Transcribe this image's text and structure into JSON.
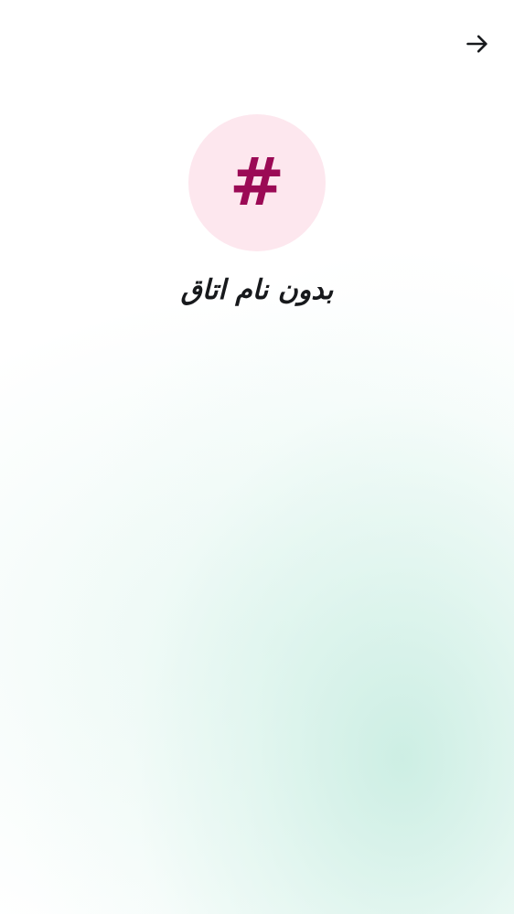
{
  "header": {
    "back_icon": "arrow-right-icon"
  },
  "room": {
    "avatar_glyph": "#",
    "name": "بدون نام اتاق"
  },
  "colors": {
    "avatar_background": "#fde7ee",
    "avatar_glyph": "#9b0a55",
    "text_primary": "#17191c",
    "background_glow": "#d6f2e9"
  }
}
